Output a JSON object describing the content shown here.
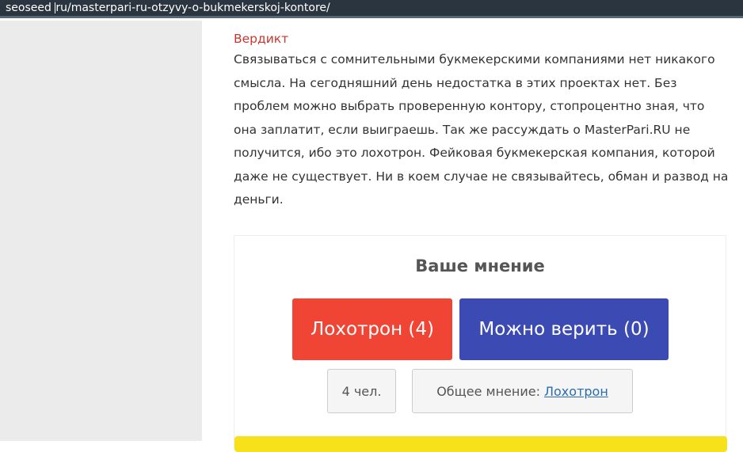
{
  "address_bar": {
    "text_before_cursor": "seoseed ",
    "text_after_cursor": "ru/masterpari-ru-otzyvy-o-bukmekerskoj-kontore/"
  },
  "article": {
    "heading": "Вердикт",
    "paragraph": "Связываться с сомнительными букмекерскими компаниями нет никакого смысла. На сегодняшний день недостатка в этих проектах нет. Без проблем можно выбрать проверенную контору, стопроцентно зная, что она заплатит, если выиграешь. Так же рассуждать о MasterPari.RU не получится, ибо это лохотрон. Фейковая букмекерская компания, которой даже не существует. Ни в коем случае не связывайтесь, обман и развод на деньги."
  },
  "poll": {
    "title": "Ваше мнение",
    "scam_button": "Лохотрон (4)",
    "trust_button": "Можно верить (0)",
    "votes": "4 чел.",
    "overall_label": "Общее мнение:",
    "overall_value": "Лохотрон"
  }
}
